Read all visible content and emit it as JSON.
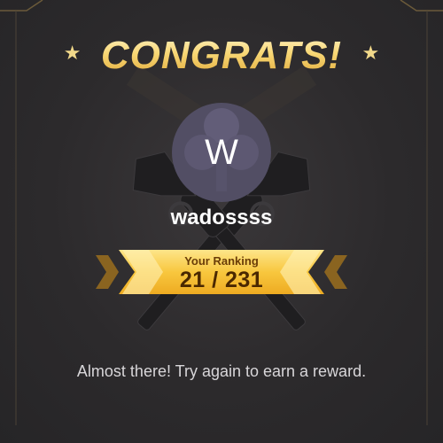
{
  "header": {
    "title": "CONGRATS!"
  },
  "player": {
    "avatar_letter": "W",
    "username": "wadossss"
  },
  "ranking": {
    "label": "Your Ranking",
    "value": "21 / 231"
  },
  "message": "Almost there! Try again to earn a reward.",
  "icons": {
    "header_left": "star-icon",
    "header_right": "star-icon",
    "background": "crossed-revolvers-icon"
  },
  "colors": {
    "background": "#2b2a2c",
    "gold": "#f6d77e",
    "banner_gold": "#f8c53a",
    "avatar": "#524e64",
    "text": "#d8d6d9"
  }
}
